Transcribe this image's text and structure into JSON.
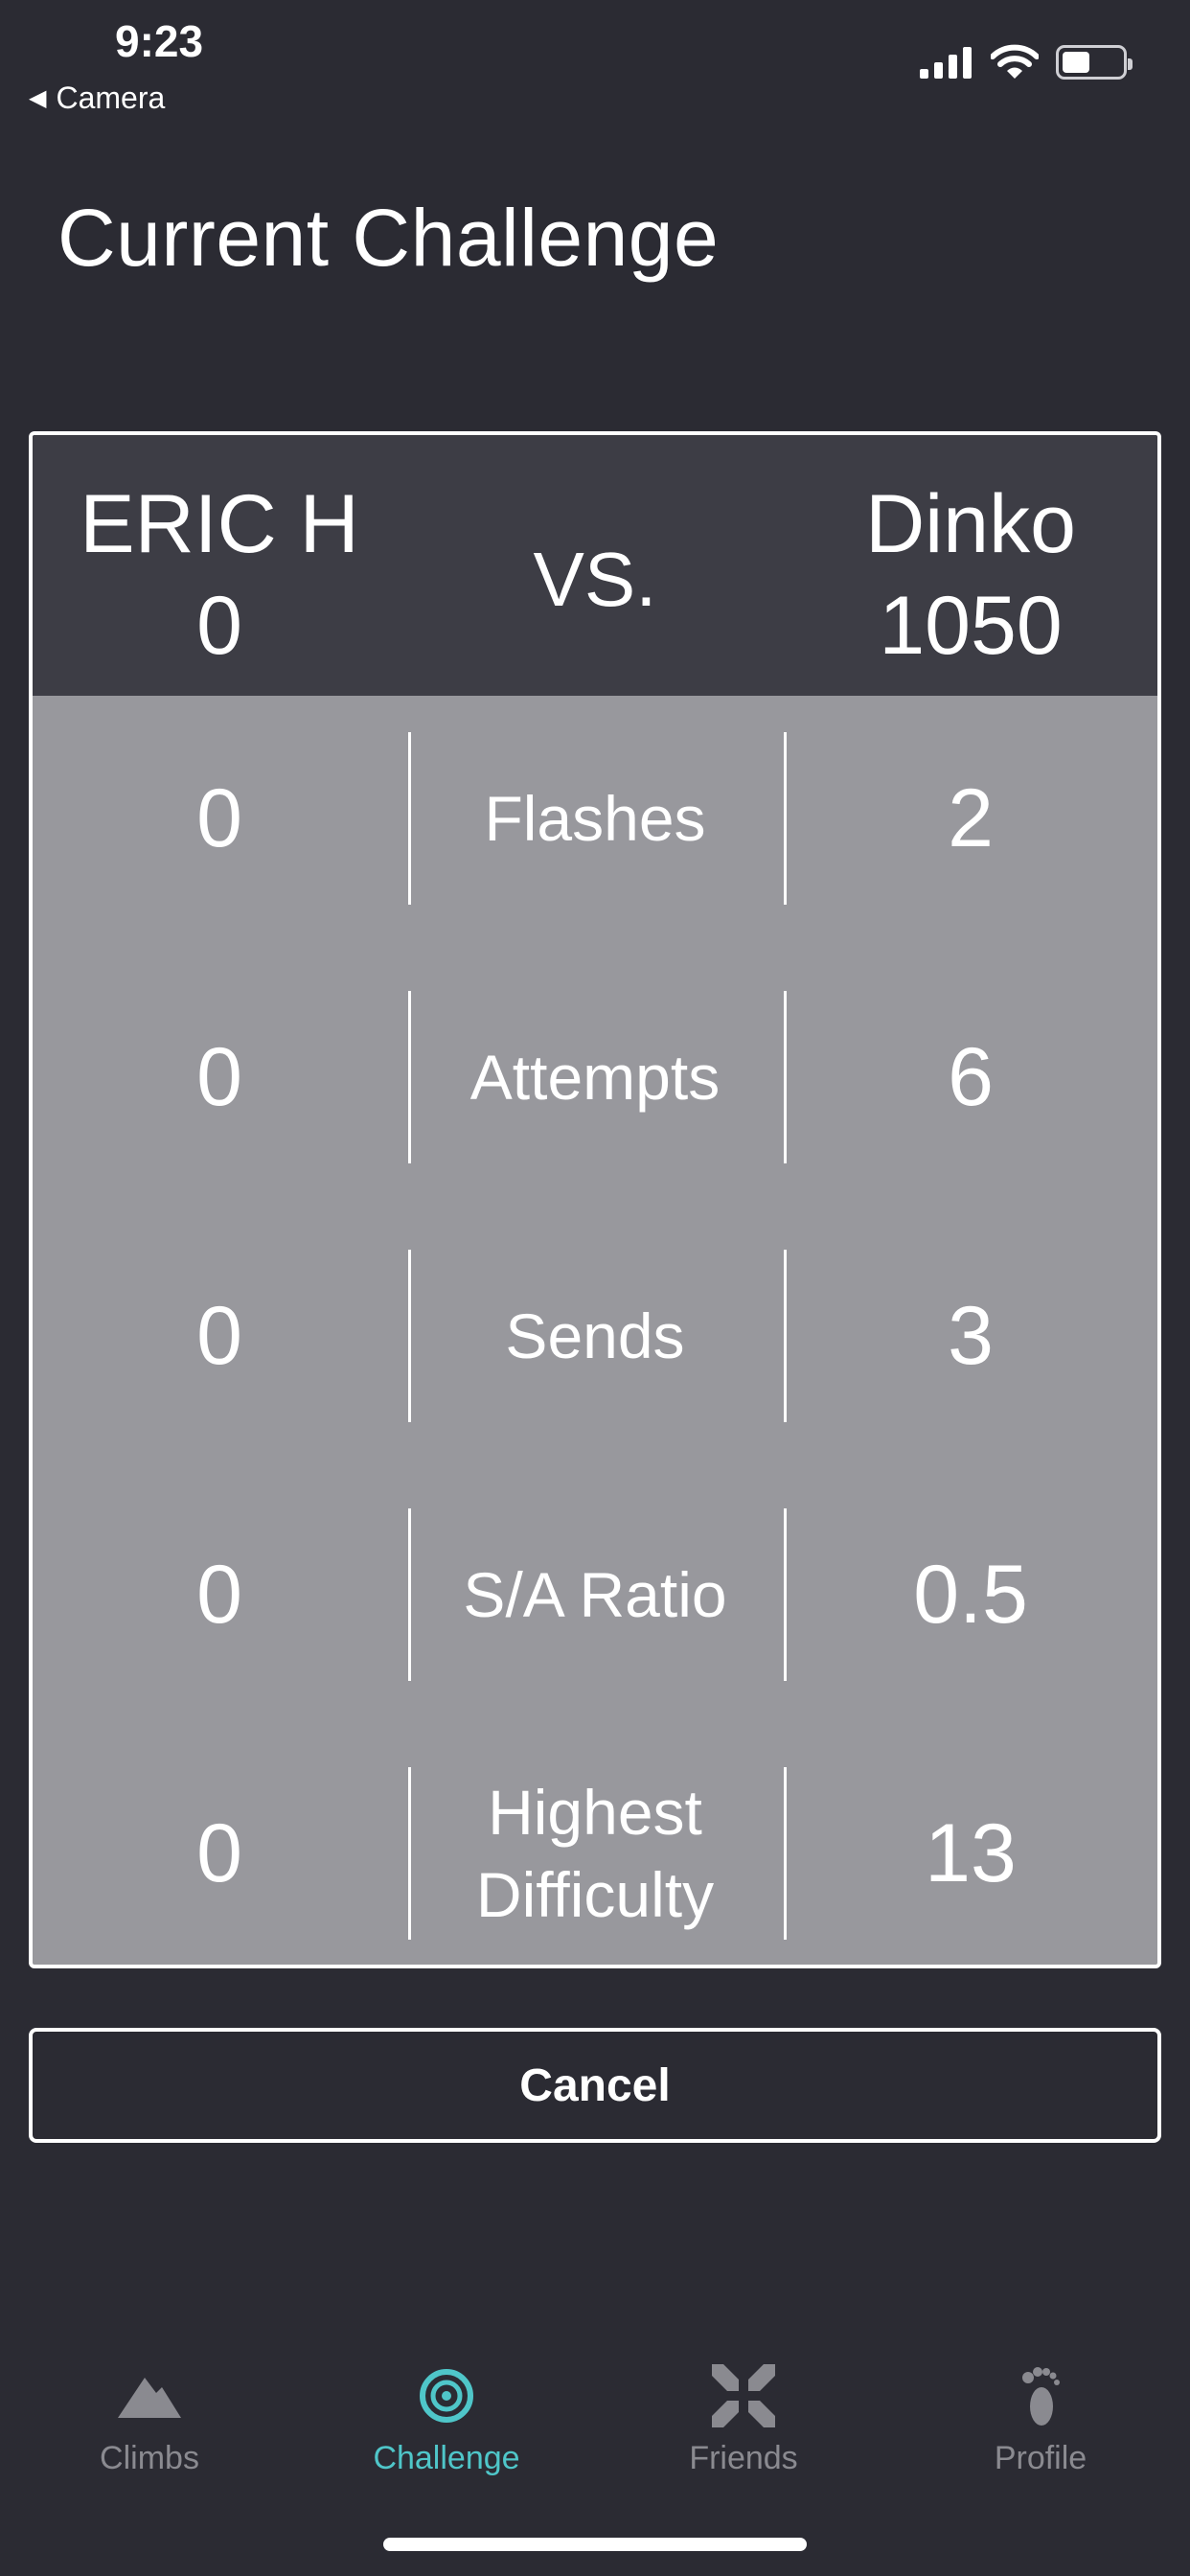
{
  "status": {
    "time": "9:23",
    "back_label": "Camera"
  },
  "page": {
    "title": "Current Challenge"
  },
  "challenge": {
    "player1": {
      "name": "ERIC H",
      "score": "0"
    },
    "player2": {
      "name": "Dinko",
      "score": "1050"
    },
    "vs_label": "VS.",
    "rows": [
      {
        "label": "Flashes",
        "p1": "0",
        "p2": "2"
      },
      {
        "label": "Attempts",
        "p1": "0",
        "p2": "6"
      },
      {
        "label": "Sends",
        "p1": "0",
        "p2": "3"
      },
      {
        "label": "S/A Ratio",
        "p1": "0",
        "p2": "0.5"
      },
      {
        "label": "Highest Difficulty",
        "p1": "0",
        "p2": "13"
      }
    ]
  },
  "actions": {
    "cancel_label": "Cancel"
  },
  "tabbar": {
    "items": [
      {
        "label": "Climbs",
        "icon": "mountain-icon"
      },
      {
        "label": "Challenge",
        "icon": "target-icon"
      },
      {
        "label": "Friends",
        "icon": "arrows-inward-icon"
      },
      {
        "label": "Profile",
        "icon": "footprint-icon"
      }
    ],
    "active": "Challenge",
    "active_color": "#4fc6c9",
    "inactive_color": "#8a8a90"
  },
  "colors": {
    "background": "#2b2b33",
    "card_header": "#3d3d45",
    "card_body": "#98989d"
  }
}
